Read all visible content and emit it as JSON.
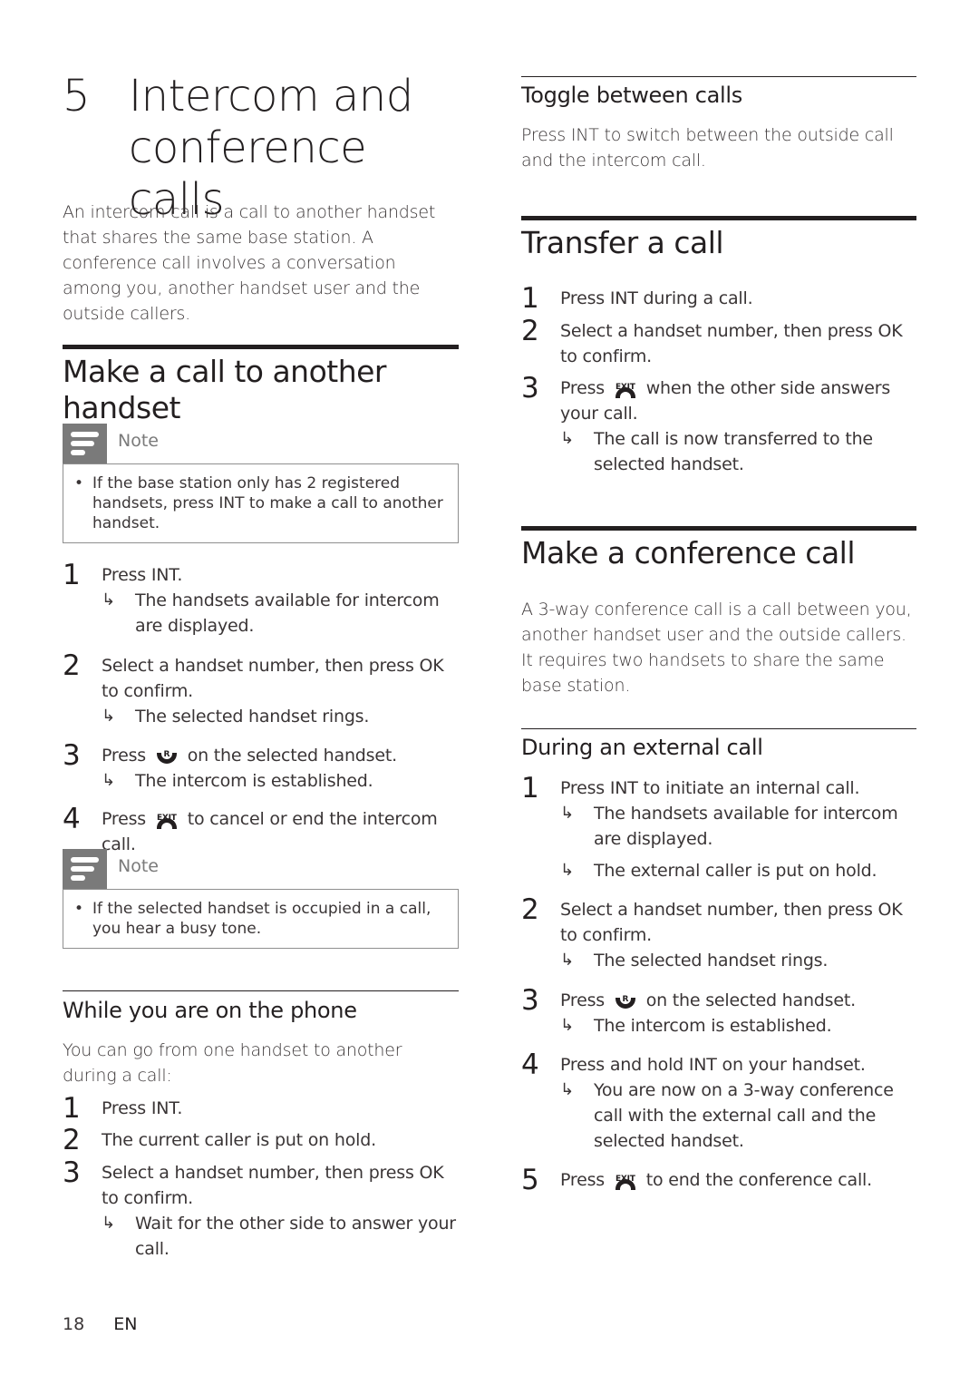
{
  "chapter": {
    "number": "5",
    "title": "Intercom and conference calls"
  },
  "intro": "An intercom call is a call to another handset that shares the same base station. A conference call involves a conversation among you, another handset user and the outside callers.",
  "make_call": {
    "heading": "Make a call to another handset",
    "note1": {
      "label": "Note",
      "bullet": "•",
      "text": "If the base station only has 2 registered handsets, press INT to make a call to another handset."
    },
    "steps": [
      {
        "num": "1",
        "text": "Press INT.",
        "results": [
          "The handsets available for intercom are displayed."
        ]
      },
      {
        "num": "2",
        "text": "Select a handset number, then press OK to confirm.",
        "results": [
          "The selected handset rings."
        ]
      },
      {
        "num": "3",
        "text_before": "Press",
        "icon": "talk-key-R",
        "icon_label": "R",
        "text_after": "on the selected handset.",
        "results": [
          "The intercom is established."
        ]
      },
      {
        "num": "4",
        "text_before": "Press",
        "icon": "end-key-EXIT",
        "icon_label": "EXIT",
        "text_after": "to cancel or end the intercom call."
      }
    ],
    "note2": {
      "label": "Note",
      "bullet": "•",
      "text": "If the selected handset is occupied in a call, you hear a busy tone."
    }
  },
  "while_on_phone": {
    "heading": "While you are on the phone",
    "intro": "You can go from one handset to another during a call:",
    "steps": [
      {
        "num": "1",
        "text": "Press INT."
      },
      {
        "num": "2",
        "text": "The current caller is put on hold."
      },
      {
        "num": "3",
        "text": "Select a handset number, then press OK to confirm.",
        "results": [
          "Wait for the other side to answer your call."
        ]
      }
    ]
  },
  "toggle": {
    "heading": "Toggle between calls",
    "text": "Press INT to switch between the outside call and the intercom call."
  },
  "transfer": {
    "heading": "Transfer a call",
    "steps": [
      {
        "num": "1",
        "text": "Press INT during a call."
      },
      {
        "num": "2",
        "text": "Select a handset number, then press OK to confirm."
      },
      {
        "num": "3",
        "text_before": "Press",
        "icon": "end-key-EXIT",
        "icon_label": "EXIT",
        "text_after": "when the other side answers your call.",
        "results": [
          "The call is now transferred to the selected handset."
        ]
      }
    ]
  },
  "conference": {
    "heading": "Make a conference call",
    "intro": "A 3-way conference call is a call between you, another handset user and the outside callers. It requires two handsets to share the same base station.",
    "subheading": "During an external call",
    "steps": [
      {
        "num": "1",
        "text": "Press INT to initiate an internal call.",
        "results": [
          "The handsets available for intercom are displayed.",
          "The external caller is put on hold."
        ]
      },
      {
        "num": "2",
        "text": "Select a handset number, then press OK to confirm.",
        "results": [
          "The selected handset rings."
        ]
      },
      {
        "num": "3",
        "text_before": "Press",
        "icon": "talk-key-R",
        "icon_label": "R",
        "text_after": "on the selected handset.",
        "results": [
          "The intercom is established."
        ]
      },
      {
        "num": "4",
        "text": "Press and hold INT on your handset.",
        "results": [
          "You are now on a 3-way conference call with the external call and the selected handset."
        ]
      },
      {
        "num": "5",
        "text_before": "Press",
        "icon": "end-key-EXIT",
        "icon_label": "EXIT",
        "text_after": "to end the conference call."
      }
    ]
  },
  "footer": {
    "page": "18",
    "lang": "EN"
  },
  "symbols": {
    "result_arrow": "↳"
  }
}
